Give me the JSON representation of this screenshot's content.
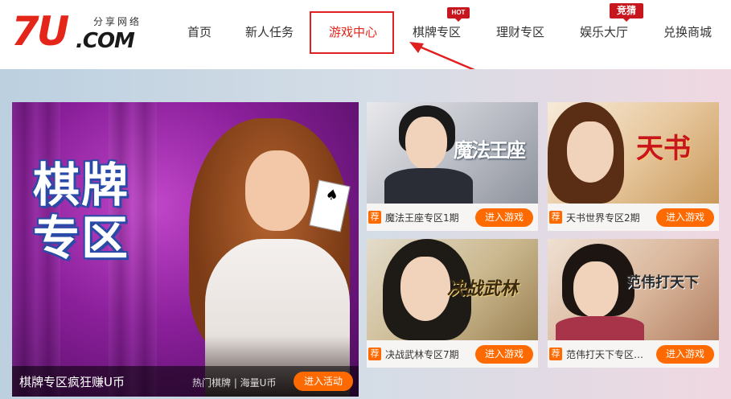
{
  "brand": {
    "logo_main": "7U",
    "logo_suffix": ".COM",
    "logo_cn": "分享网络"
  },
  "nav": {
    "items": [
      {
        "label": "首页"
      },
      {
        "label": "新人任务"
      },
      {
        "label": "游戏中心"
      },
      {
        "label": "棋牌专区"
      },
      {
        "label": "理财专区"
      },
      {
        "label": "娱乐大厅"
      },
      {
        "label": "兑换商城"
      }
    ],
    "badges": {
      "hot": "HOT",
      "guess": "竞猜"
    },
    "active_index": 2
  },
  "feature": {
    "art_title_line1": "棋牌",
    "art_title_line2": "专区",
    "title": "棋牌专区疯狂赚U币",
    "tags": "热门棋牌 | 海量U币",
    "button": "进入活动"
  },
  "games": [
    {
      "tag": "荐",
      "title": "魔法王座专区1期",
      "logo": "魔法王座",
      "button": "进入游戏"
    },
    {
      "tag": "荐",
      "title": "天书世界专区2期",
      "logo": "天书",
      "button": "进入游戏"
    },
    {
      "tag": "荐",
      "title": "决战武林专区7期",
      "logo": "决战武林",
      "button": "进入游戏"
    },
    {
      "tag": "荐",
      "title": "范伟打天下专区…",
      "logo": "范伟打天下",
      "button": "进入游戏"
    }
  ],
  "colors": {
    "brand_red": "#e4261a",
    "button_orange": "#ff6a00",
    "highlight_box": "#e02020"
  }
}
